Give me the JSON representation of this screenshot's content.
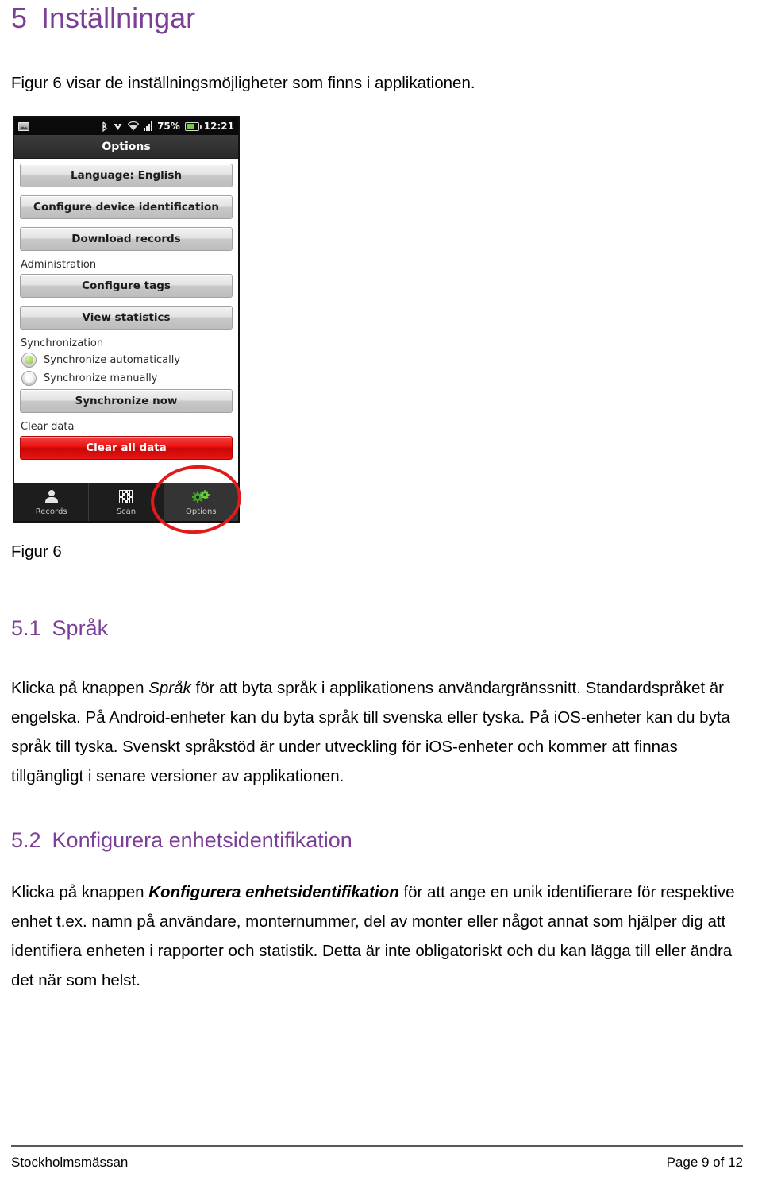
{
  "document": {
    "heading_1": {
      "number": "5",
      "title": "Inställningar"
    },
    "intro_paragraph": "Figur 6 visar de inställningsmöjligheter som finns i applikationen.",
    "figure_caption": "Figur 6",
    "section_5_1": {
      "number": "5.1",
      "title": "Språk",
      "paragraph_part_1": "Klicka på knappen ",
      "paragraph_emphasis": "Språk",
      "paragraph_part_2": " för att byta språk i applikationens användargränssnitt. Standardspråket är engelska. På Android-enheter kan du byta språk till svenska eller tyska. På iOS-enheter kan du byta språk till tyska. Svenskt språkstöd är under utveckling för iOS-enheter och kommer att finnas tillgängligt i senare versioner av applikationen."
    },
    "section_5_2": {
      "number": "5.2",
      "title": "Konfigurera enhetsidentifikation",
      "paragraph_part_1": "Klicka på knappen ",
      "paragraph_emphasis": "Konfigurera enhetsidentifikation",
      "paragraph_part_2": " för att ange en unik identifierare för respektive enhet t.ex. namn på användare, monternummer, del av monter eller något annat som hjälper dig att identifiera enheten i rapporter och statistik. Detta är inte obligatoriskt och du kan lägga till eller ändra det när som helst."
    },
    "footer": {
      "left": "Stockholmsmässan",
      "right": "Page 9 of 12"
    },
    "colors": {
      "heading_purple": "#7b3f98",
      "annotation_red": "#e01b1b",
      "danger_red": "#ee1111",
      "accent_green": "#8dc63f"
    }
  },
  "figure": {
    "status_bar": {
      "screenshot_icon": "image-icon",
      "bluetooth_icon": "bluetooth-icon",
      "sync_icon": "sync-icon",
      "wifi_icon": "wifi-icon",
      "signal_icon": "signal-bars-icon",
      "battery_percent": "75%",
      "battery_icon": "battery-icon",
      "time": "12:21"
    },
    "title_bar": {
      "title": "Options"
    },
    "buttons": {
      "language": "Language: English",
      "configure_device": "Configure device identification",
      "download_records": "Download records",
      "configure_tags": "Configure tags",
      "view_statistics": "View statistics",
      "synchronize_now": "Synchronize now",
      "clear_all_data": "Clear all data"
    },
    "group_labels": {
      "administration": "Administration",
      "synchronization": "Synchronization",
      "clear_data": "Clear data"
    },
    "radios": [
      {
        "label": "Synchronize automatically",
        "selected": true
      },
      {
        "label": "Synchronize manually",
        "selected": false
      }
    ],
    "tabs": [
      {
        "label": "Records",
        "icon": "person-icon",
        "active": false
      },
      {
        "label": "Scan",
        "icon": "qr-code-icon",
        "active": false
      },
      {
        "label": "Options",
        "icon": "gears-icon",
        "active": true
      }
    ]
  }
}
